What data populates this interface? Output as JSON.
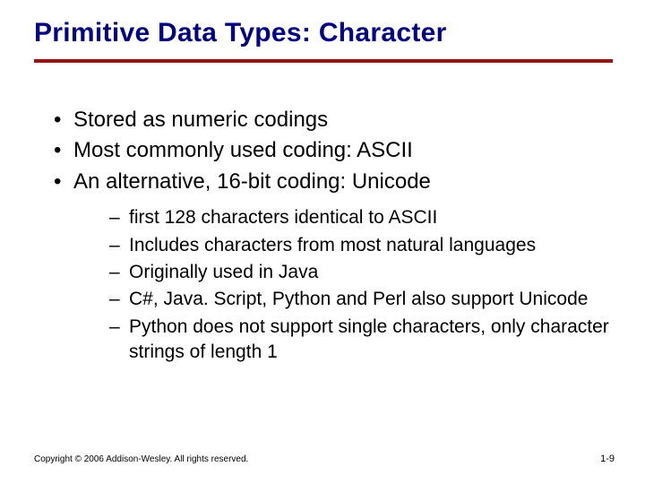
{
  "title": "Primitive Data Types: Character",
  "bullets": [
    "Stored as numeric codings",
    "Most commonly used coding: ASCII",
    "An alternative, 16-bit coding: Unicode"
  ],
  "subbullets": [
    "first 128 characters identical to ASCII",
    "Includes characters from most natural languages",
    "Originally used in Java",
    "C#, Java. Script, Python and Perl also support Unicode",
    "Python does not support single characters, only character strings of length 1"
  ],
  "footer": {
    "copyright": "Copyright © 2006 Addison-Wesley. All rights reserved.",
    "pagenum": "1-9"
  }
}
